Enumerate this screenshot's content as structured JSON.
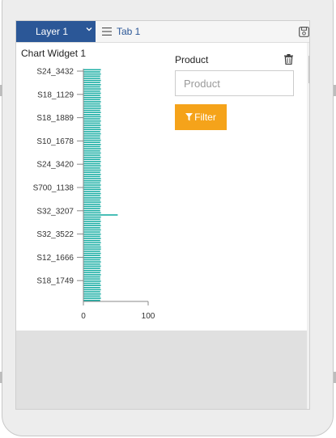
{
  "tabbar": {
    "layer_label": "Layer 1",
    "tab_label": "Tab 1",
    "icons": {
      "layer_dropdown": "chevron-down-icon",
      "tab_menu": "menu-icon",
      "save": "save-icon"
    }
  },
  "widget": {
    "title": "Chart Widget 1"
  },
  "filter": {
    "label": "Product",
    "placeholder": "Product",
    "button_label": "Filter",
    "icons": {
      "remove": "trash-icon",
      "filter": "filter-icon"
    },
    "button_color": "#f5a31a"
  },
  "colors": {
    "layer_tab": "#2b5797",
    "bar": "#1aaea4"
  },
  "chart_data": {
    "type": "bar",
    "orientation": "horizontal",
    "title": "",
    "xlabel": "",
    "ylabel": "",
    "xlim": [
      0,
      100
    ],
    "x_ticks": [
      "0",
      "100"
    ],
    "y_tick_labels": [
      "S24_3432",
      "S18_1129",
      "S18_1889",
      "S10_1678",
      "S24_3420",
      "S700_1138",
      "S32_3207",
      "S32_3522",
      "S12_1666",
      "S18_1749"
    ],
    "series": [
      {
        "values": [
          27,
          26,
          27,
          26,
          26,
          27,
          26,
          27,
          26,
          27,
          26,
          27,
          26,
          27,
          26,
          27,
          26,
          27,
          27,
          26,
          27,
          26,
          27,
          26,
          27,
          26,
          27,
          26,
          27,
          26,
          27,
          26,
          26,
          27,
          26,
          27,
          26,
          27,
          26,
          27,
          26,
          27,
          26,
          27,
          26,
          27,
          26,
          27,
          26,
          27,
          26,
          27,
          27,
          26,
          27,
          26,
          27,
          26,
          27,
          26,
          27,
          26,
          27,
          26,
          27,
          26,
          26,
          27,
          53,
          27,
          26,
          27,
          26,
          27,
          26,
          27,
          26,
          27,
          26,
          27,
          26,
          27,
          26,
          27,
          27,
          26,
          27,
          26,
          27,
          26,
          27,
          26,
          27,
          26,
          27,
          26,
          27,
          26,
          26,
          27,
          26,
          27,
          26,
          27,
          26,
          27,
          26,
          27,
          26
        ]
      }
    ]
  }
}
